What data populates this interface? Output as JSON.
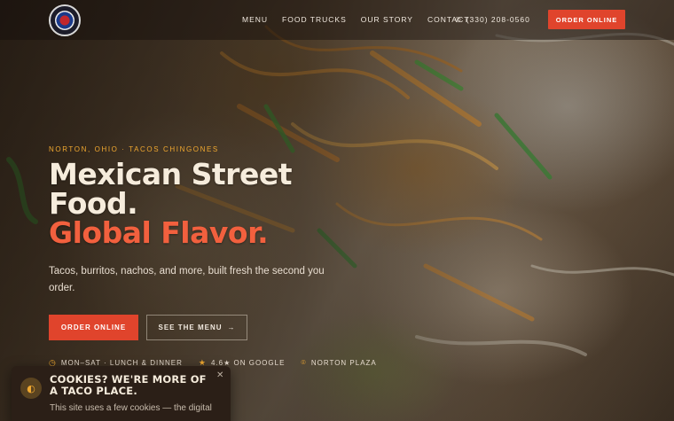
{
  "header": {
    "logo_alt": "logo",
    "nav": [
      "MENU",
      "FOOD TRUCKS",
      "OUR STORY",
      "CONTACT"
    ],
    "phone": "(330) 208-0560",
    "order_label": "ORDER ONLINE"
  },
  "hero": {
    "eyebrow": "NORTON, OHIO · TACOS CHINGONES",
    "headline_line1": "Mexican Street",
    "headline_line2": "Food.",
    "headline_accent": "Global Flavor.",
    "subtext": "Tacos, burritos, nachos, and more, built fresh the second you order.",
    "primary_cta": "ORDER ONLINE",
    "secondary_cta": "SEE THE MENU",
    "meta": [
      {
        "icon": "clock-icon",
        "text": "MON–SAT · LUNCH & DINNER"
      },
      {
        "icon": "star-icon",
        "text": "4.6★ ON GOOGLE"
      },
      {
        "icon": "map-pin-icon",
        "text": "NORTON PLAZA"
      }
    ]
  },
  "cookie": {
    "title": "COOKIES? WE'RE MORE OF A TACO PLACE.",
    "body": "This site uses a few cookies — the digital"
  },
  "colors": {
    "accent": "#e0442c",
    "headline_accent": "#f2603e",
    "eyebrow": "#f0a830",
    "cookie_bg": "#2b1f17"
  }
}
